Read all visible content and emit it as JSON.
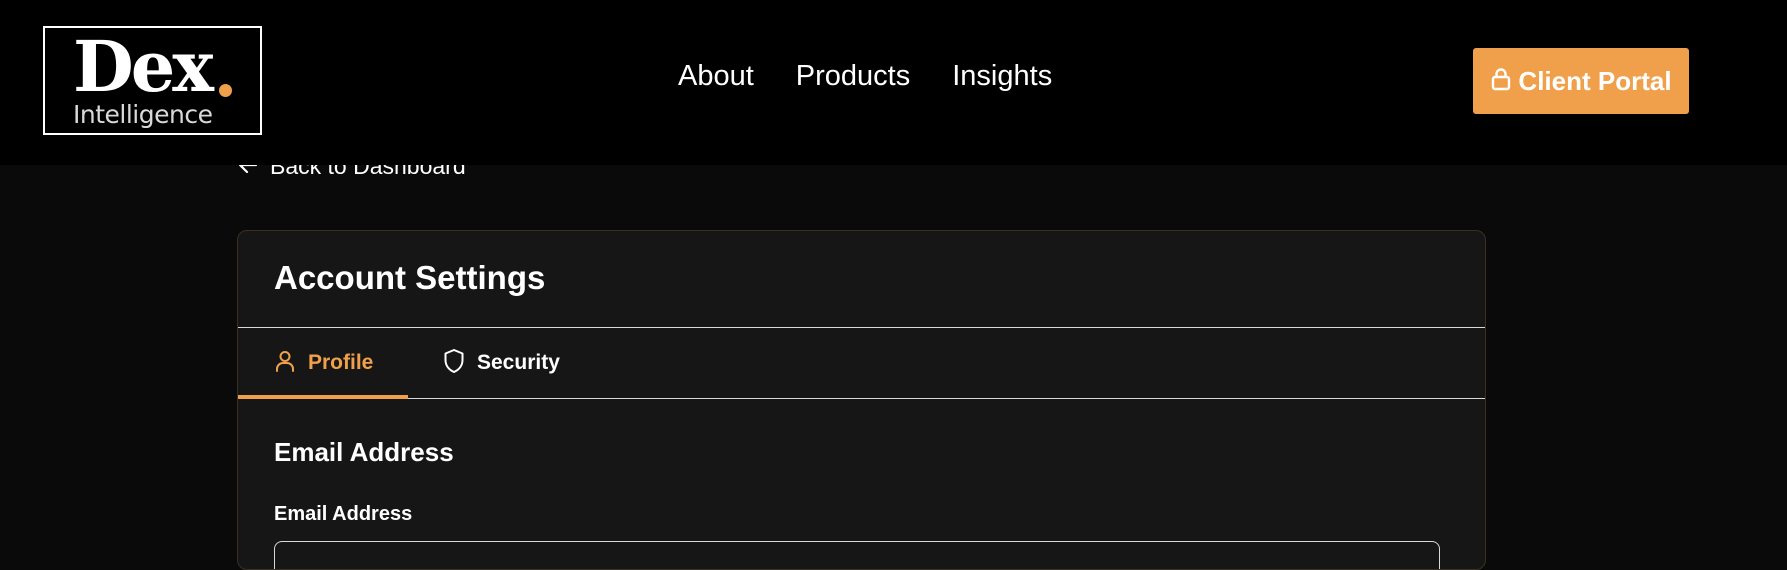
{
  "header": {
    "logo": {
      "wordmark": "Dex",
      "subtitle": "Intelligence"
    },
    "nav": [
      {
        "label": "About"
      },
      {
        "label": "Products"
      },
      {
        "label": "Insights"
      }
    ],
    "portal_button": {
      "label": "Client Portal",
      "icon": "lock-icon"
    }
  },
  "back_link": {
    "label": "Back to Dashboard",
    "icon": "arrow-left-icon"
  },
  "settings": {
    "title": "Account Settings",
    "tabs": [
      {
        "label": "Profile",
        "icon": "user-icon",
        "active": true
      },
      {
        "label": "Security",
        "icon": "shield-icon",
        "active": false
      }
    ],
    "section_title": "Email Address",
    "email_field": {
      "label": "Email Address"
    }
  },
  "colors": {
    "accent": "#f0a04b",
    "header_bg": "#000000",
    "page_bg": "#0a0a0a",
    "card_bg": "#161616",
    "text": "#ffffff"
  }
}
